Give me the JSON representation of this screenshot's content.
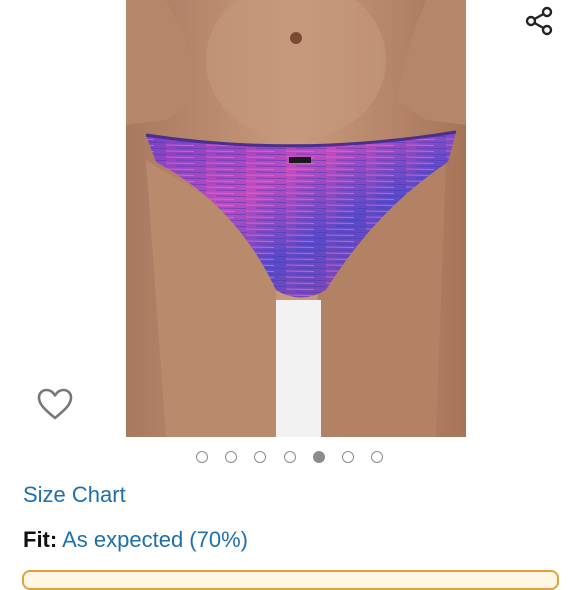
{
  "product": {
    "image_alt": "Product photo: purple and pink space-dye men's bikini brief",
    "image_count": 7,
    "active_image_index": 4
  },
  "actions": {
    "share_icon": "share-icon",
    "wishlist_icon": "heart-outline-icon"
  },
  "size_chart": {
    "label": "Size Chart"
  },
  "fit": {
    "label": "Fit:",
    "value": "As expected (70%)"
  },
  "colors": {
    "link": "#1f6fab",
    "dot": "#8c8c8c",
    "button_border": "#e0a33b"
  }
}
